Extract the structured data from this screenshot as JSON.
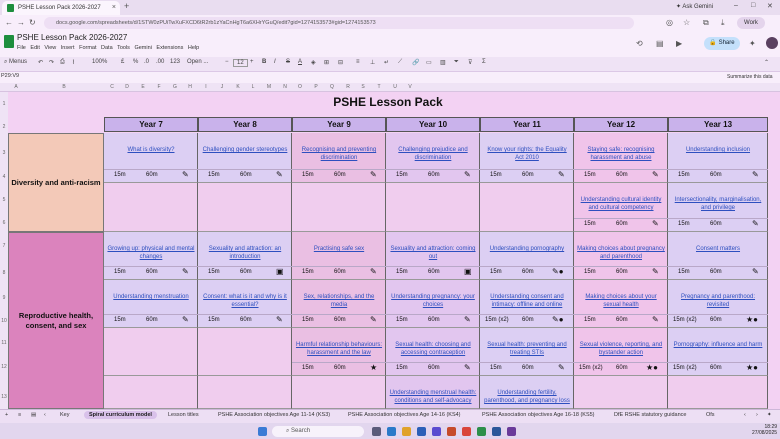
{
  "browser": {
    "tab_title": "PSHE Lesson Pack 2026-2027",
    "tab_close": "×",
    "new_tab": "+",
    "ask_gemini": "Ask Gemini",
    "url": "docs.google.com/spreadsheets/d/1STW0zPUiTwXuFXCD6tR2rb1zYaCnHgT6a6XHrYGuQ/edit?gid=1274153573#gid=1274153573",
    "profile": "Work",
    "win_min": "–",
    "win_max": "□",
    "win_close": "✕"
  },
  "doc": {
    "title": "PSHE Lesson Pack 2026-2027",
    "menus": [
      "File",
      "Edit",
      "View",
      "Insert",
      "Format",
      "Data",
      "Tools",
      "Gemini",
      "Extensions",
      "Help"
    ],
    "share": "Share"
  },
  "toolbar": {
    "menus_label": "Menus",
    "zoom": "100%",
    "currency": "£",
    "percent": "%",
    "decimal1": ".0",
    "decimal2": ".00",
    "number_format": "123",
    "font": "Open ...",
    "font_size": "12",
    "bold": "B",
    "italic": "I",
    "strike": "S",
    "textcolor": "A"
  },
  "formula": {
    "namebox": "P29:V9",
    "summarize": "Summarize this data"
  },
  "columns": [
    "A",
    "B",
    "C",
    "D",
    "E",
    "F",
    "G",
    "H",
    "I",
    "J",
    "K",
    "L",
    "M",
    "N",
    "O",
    "P",
    "Q",
    "R",
    "S",
    "T",
    "U",
    "V"
  ],
  "rows": [
    "1",
    "2",
    "3",
    "4",
    "5",
    "6",
    "7",
    "8",
    "9",
    "10",
    "11",
    "12",
    "13"
  ],
  "sheet": {
    "title": "PSHE Lesson Pack",
    "years": [
      "Year 7",
      "Year 8",
      "Year 9",
      "Year 10",
      "Year 11",
      "Year 12",
      "Year 13"
    ],
    "sections": [
      "Diversity and anti-racism",
      "Reproductive health, consent, and sex"
    ],
    "lessons": [
      {
        "title": "What is diversity?",
        "short": "15m",
        "long": "60m",
        "icon": "pencil-icon",
        "glyph": "✎"
      },
      {
        "title": "Challenging gender stereotypes",
        "short": "15m",
        "long": "60m",
        "icon": "pencil-icon",
        "glyph": "✎"
      },
      {
        "title": "Recognising and preventing discrimination",
        "short": "15m",
        "long": "60m",
        "icon": "pencil-icon",
        "glyph": "✎"
      },
      {
        "title": "Challenging prejudice and discrimination",
        "short": "15m",
        "long": "60m",
        "icon": "pencil-icon",
        "glyph": "✎"
      },
      {
        "title": "Know your rights: the Equality Act 2010",
        "short": "15m",
        "long": "60m",
        "icon": "pencil-icon",
        "glyph": "✎"
      },
      {
        "title": "Staying safe: recognising harassment and abuse",
        "short": "15m",
        "long": "60m",
        "icon": "pencil-icon",
        "glyph": "✎"
      },
      {
        "title": "Understanding inclusion",
        "short": "15m",
        "long": "60m",
        "icon": "pencil-icon",
        "glyph": "✎"
      },
      {
        "title": "Understanding cultural identity and cultural competency",
        "short": "15m",
        "long": "60m",
        "icon": "pencil-icon",
        "glyph": "✎"
      },
      {
        "title": "Intersectionality, marginalisation, and privilege",
        "short": "15m",
        "long": "60m",
        "icon": "pencil-icon",
        "glyph": "✎"
      },
      {
        "title": "Growing up: physical and mental changes",
        "short": "15m",
        "long": "60m",
        "icon": "pencil-icon",
        "glyph": "✎"
      },
      {
        "title": "Sexuality and attraction: an introduction",
        "short": "15m",
        "long": "60m",
        "icon": "video-icon",
        "glyph": "▣"
      },
      {
        "title": "Practising safe sex",
        "short": "15m",
        "long": "60m",
        "icon": "pencil-icon",
        "glyph": "✎"
      },
      {
        "title": "Sexuality and attraction: coming out",
        "short": "15m",
        "long": "60m",
        "icon": "video-icon",
        "glyph": "▣"
      },
      {
        "title": "Understanding pornography",
        "short": "15m",
        "long": "60m",
        "icon": "pencil-dot-icon",
        "glyph": "✎●"
      },
      {
        "title": "Making choices about pregnancy and parenthood",
        "short": "15m",
        "long": "60m",
        "icon": "pencil-icon",
        "glyph": "✎"
      },
      {
        "title": "Consent matters",
        "short": "15m",
        "long": "60m",
        "icon": "pencil-icon",
        "glyph": "✎"
      },
      {
        "title": "Understanding menstruation",
        "short": "15m",
        "long": "60m",
        "icon": "pencil-icon",
        "glyph": "✎"
      },
      {
        "title": "Consent: what is it and why is it essential?",
        "short": "15m",
        "long": "60m",
        "icon": "pencil-icon",
        "glyph": "✎"
      },
      {
        "title": "Sex, relationships, and the media",
        "short": "15m",
        "long": "60m",
        "icon": "pencil-icon",
        "glyph": "✎"
      },
      {
        "title": "Understanding pregnancy: your choices",
        "short": "15m",
        "long": "60m",
        "icon": "pencil-icon",
        "glyph": "✎"
      },
      {
        "title": "Understanding consent and intimacy: offline and online",
        "short": "15m (x2)",
        "long": "60m",
        "icon": "pencil-dot-icon",
        "glyph": "✎●"
      },
      {
        "title": "Making choices about your sexual health",
        "short": "15m",
        "long": "60m",
        "icon": "pencil-icon",
        "glyph": "✎"
      },
      {
        "title": "Pregnancy and parenthood: revisited",
        "short": "15m (x2)",
        "long": "60m",
        "icon": "star-dot-icon",
        "glyph": "★●"
      },
      {
        "title": "Harmful relationship behaviours: harassment and the law",
        "short": "15m",
        "long": "60m",
        "icon": "star-icon",
        "glyph": "★"
      },
      {
        "title": "Sexual health: choosing and accessing contraception",
        "short": "15m",
        "long": "60m",
        "icon": "pencil-icon",
        "glyph": "✎"
      },
      {
        "title": "Sexual health: preventing and treating STIs",
        "short": "15m",
        "long": "60m",
        "icon": "pencil-icon",
        "glyph": "✎"
      },
      {
        "title": "Sexual violence, reporting, and bystander action",
        "short": "15m (x2)",
        "long": "60m",
        "icon": "star-dot-icon",
        "glyph": "★●"
      },
      {
        "title": "Pornography: influence and harm",
        "short": "15m (x2)",
        "long": "60m",
        "icon": "star-dot-icon",
        "glyph": "★●"
      },
      {
        "title": "Understanding menstrual health: conditions and self-advocacy",
        "short": "",
        "long": "",
        "icon": "",
        "glyph": ""
      },
      {
        "title": "Understanding fertility, parenthood, and pregnancy loss",
        "short": "",
        "long": "",
        "icon": "",
        "glyph": ""
      }
    ]
  },
  "sheet_tabs": [
    "Key",
    "Spiral curriculum model",
    "Lesson titles",
    "PSHE Association objectives Age 11-14 (KS3)",
    "PSHE Association objectives Age 14-16 (KS4)",
    "PSHE Association objectives Age 16-18 (KS5)",
    "DfE RSHE statutory guidance",
    "Ofs"
  ],
  "taskbar": {
    "search": "Search",
    "time": "18:29",
    "date": "27/08/2025"
  },
  "colors": {
    "sheet_bg": "#f3d2f3",
    "year_header": "#c9b2eb",
    "diversity": "#f3c9b8",
    "repro": "#db83bd",
    "link": "#2d4fbf"
  }
}
